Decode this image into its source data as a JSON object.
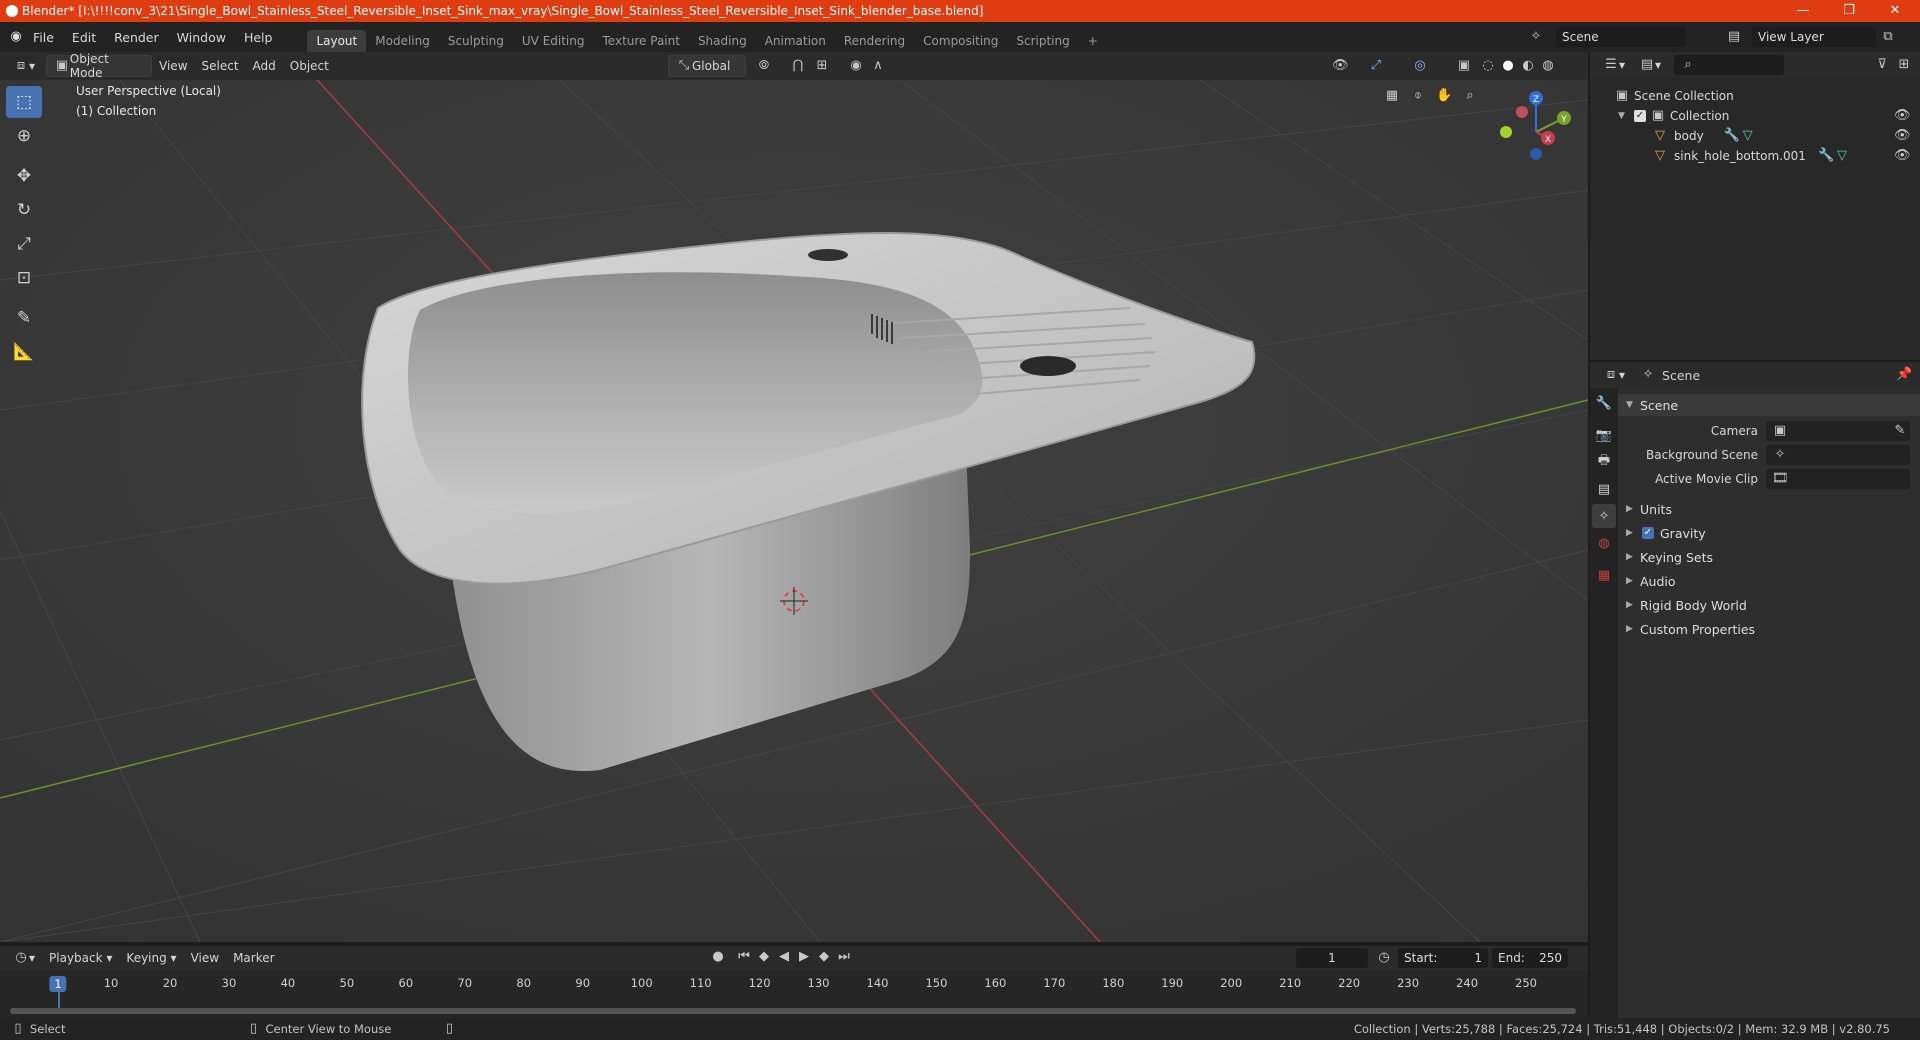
{
  "titlebar": {
    "title": "Blender* [I:\\!!!!conv_3\\21\\Single_Bowl_Stainless_Steel_Reversible_Inset_Sink_max_vray\\Single_Bowl_Stainless_Steel_Reversible_Inset_Sink_blender_base.blend]",
    "minimize": "—",
    "maximize": "❐",
    "close": "✕"
  },
  "menu": {
    "items": [
      "File",
      "Edit",
      "Render",
      "Window",
      "Help"
    ],
    "workspaces": [
      "Layout",
      "Modeling",
      "Sculpting",
      "UV Editing",
      "Texture Paint",
      "Shading",
      "Animation",
      "Rendering",
      "Compositing",
      "Scripting"
    ],
    "add_workspace": "+",
    "scene": "Scene",
    "view_layer": "View Layer"
  },
  "viewport_header": {
    "mode": "Object Mode",
    "menus": [
      "View",
      "Select",
      "Add",
      "Object"
    ],
    "orientation": "Global"
  },
  "viewport": {
    "perspective": "User Perspective (Local)",
    "collection": "(1) Collection",
    "gizmo": {
      "z": "Z",
      "y": "Y",
      "x": "X"
    }
  },
  "timeline": {
    "menus": [
      "Playback",
      "Keying",
      "View",
      "Marker"
    ],
    "current_frame": "1",
    "start_label": "Start:",
    "start": "1",
    "end_label": "End:",
    "end": "250",
    "ticks": [
      "1",
      "10",
      "20",
      "30",
      "40",
      "50",
      "60",
      "70",
      "80",
      "90",
      "100",
      "110",
      "120",
      "130",
      "140",
      "150",
      "160",
      "170",
      "180",
      "190",
      "200",
      "210",
      "220",
      "230",
      "240",
      "250"
    ]
  },
  "statusbar": {
    "select": "Select",
    "center": "Center View to Mouse",
    "stats": "Collection | Verts:25,788 | Faces:25,724 | Tris:51,448 | Objects:0/2 | Mem: 32.9 MB | v2.80.75"
  },
  "outliner": {
    "scene_collection": "Scene Collection",
    "collection": "Collection",
    "objects": [
      "body",
      "sink_hole_bottom.001"
    ]
  },
  "properties": {
    "header": "Scene",
    "panel": "Scene",
    "camera_label": "Camera",
    "background_label": "Background Scene",
    "clip_label": "Active Movie Clip",
    "sections": [
      "Units",
      "Gravity",
      "Keying Sets",
      "Audio",
      "Rigid Body World",
      "Custom Properties"
    ]
  },
  "colors": {
    "accent": "#4772b3",
    "titlebar": "#e03c12",
    "x_axis": "#c83c4c",
    "y_axis": "#7aa12c",
    "z_axis": "#2f6fd6"
  }
}
